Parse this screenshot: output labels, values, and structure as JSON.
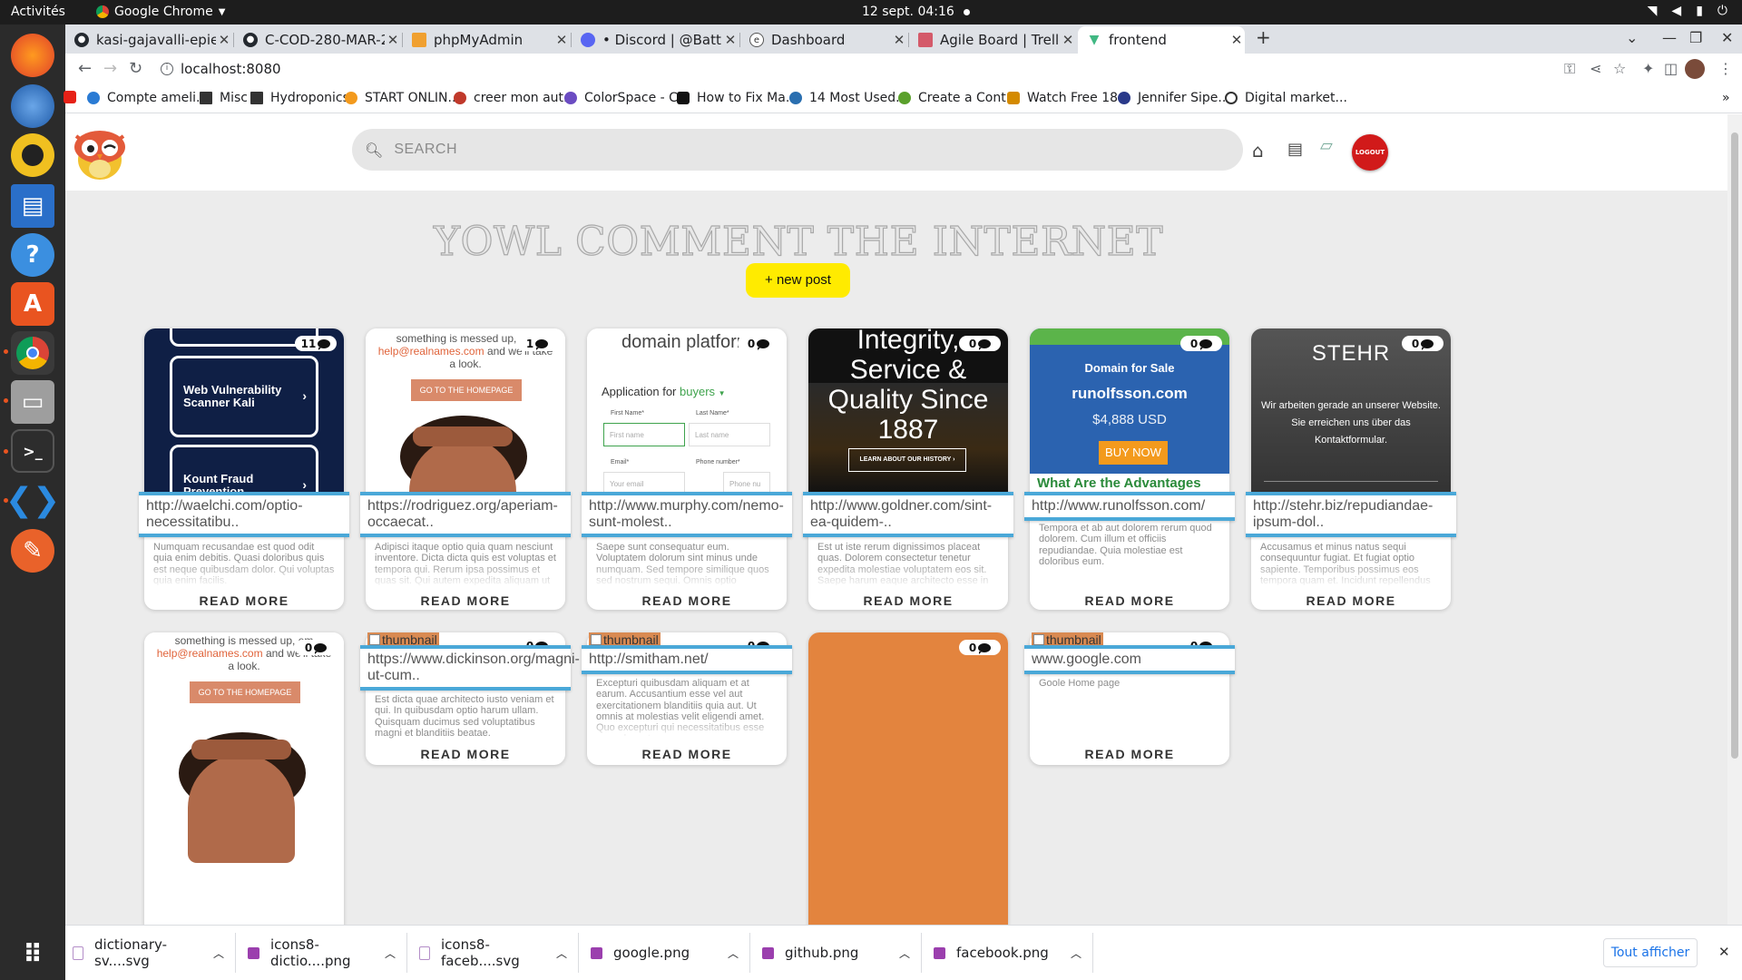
{
  "os": {
    "activities": "Activités",
    "app_name": "Google Chrome",
    "clock": "12 sept.  04:16"
  },
  "tabs": [
    {
      "title": "kasi-gajavalli-epietch/Yo",
      "icon": "github-icon"
    },
    {
      "title": "C-COD-280-MAR-2-3-dasl",
      "icon": "github-icon"
    },
    {
      "title": "phpMyAdmin",
      "icon": "phpmyadmin-icon"
    },
    {
      "title": "• Discord | @Battlemaste",
      "icon": "discord-icon"
    },
    {
      "title": "Dashboard",
      "icon": "dashboard-icon"
    },
    {
      "title": "Agile Board | Trello",
      "icon": "trello-icon"
    },
    {
      "title": "frontend",
      "icon": "vue-icon"
    }
  ],
  "omnibox": {
    "url": "localhost:8080"
  },
  "bookmarks": [
    {
      "label": "Compte ameli...",
      "color": "#2a7bd4"
    },
    {
      "label": "Misc",
      "color": "#333333"
    },
    {
      "label": "Hydroponics",
      "color": "#333333"
    },
    {
      "label": "START ONLIN...",
      "color": "#f39a1d"
    },
    {
      "label": "creer mon aut...",
      "color": "#c0392b"
    },
    {
      "label": "ColorSpace - C...",
      "color": "#6b4cc2"
    },
    {
      "label": "How to Fix Ma...",
      "color": "#111111"
    },
    {
      "label": "14 Most Used...",
      "color": "#2a6fb0"
    },
    {
      "label": "Create a Cont...",
      "color": "#5aa02c"
    },
    {
      "label": "Watch Free 18...",
      "color": "#d48a00"
    },
    {
      "label": "Jennifer Sipe...",
      "color": "#2a3a8a"
    },
    {
      "label": "Digital market...",
      "color": "#333333"
    }
  ],
  "app": {
    "search_placeholder": "SEARCH",
    "logout_label": "LOGOUT",
    "hero_title": "YOWL COMMENT THE INTERNET",
    "new_post_label": "+ new post",
    "read_more_label": "READ MORE"
  },
  "posts": [
    {
      "url": "http://waelchi.com/optio-necessitatibu..",
      "count": "11",
      "desc": "Numquam recusandae est quod odit quia enim debitis. Quasi doloribus quis est neque quibusdam dolor. Qui voluptas quia enim facilis.",
      "thumb": {
        "box1": "Web Vulnerability Scanner Kali",
        "box2": "Kount Fraud Prevention"
      }
    },
    {
      "url": "https://rodriguez.org/aperiam-occaecat..",
      "count": "1",
      "desc": "Adipisci itaque optio quia quam nesciunt inventore. Dicta dicta quis est voluptas et tempora qui. Rerum ipsa possimus et quas sit. Qui autem expedita aliquam ut sit similique asperiores qui.",
      "thumb": {
        "text1": "something is messed up, em",
        "link": "help@realnames.com",
        "text2": "and we'll take a look.",
        "button": "GO TO THE HOMEPAGE"
      }
    },
    {
      "url": "http://www.murphy.com/nemo-sunt-molest..",
      "count": "0",
      "desc": "Saepe sunt consequatur eum. Voluptatem dolorum sint minus unde numquam. Sed tempore similique quos sed nostrum sequi. Omnis optio perferendis veniam odit.",
      "thumb": {
        "heading": "domain platform",
        "application": "Application for",
        "buyers": "buyers",
        "first_name": "First Name*",
        "last_name": "Last Name*",
        "first_ph": "First name",
        "last_ph": "Last name",
        "email": "Email*",
        "phone": "Phone number*",
        "email_ph": "Your email",
        "phone_ph": "Phone nu"
      }
    },
    {
      "url": "http://www.goldner.com/sint-ea-quidem-..",
      "count": "0",
      "desc": "Est ut iste rerum dignissimos placeat quas. Dolorem consectetur tenetur expedita molestiae voluptatem eos sit. Saepe harum eaque architecto esse in quas non.",
      "thumb": {
        "big": "Integrity, Service & Quality Since 1887",
        "button": "LEARN ABOUT OUR HISTORY ›"
      }
    },
    {
      "url": "http://www.runolfsson.com/",
      "count": "0",
      "desc": "Tempora et ab aut dolorem rerum quod dolorem. Cum illum et officiis repudiandae. Quia molestiae est doloribus eum.",
      "thumb": {
        "for_sale": "Domain for Sale",
        "domain": "runolfsson.com",
        "price": "$4,888 USD",
        "buy": "BUY NOW",
        "adv": "What Are the Advantages"
      }
    },
    {
      "url": "http://stehr.biz/repudiandae-ipsum-dol..",
      "count": "0",
      "desc": "Accusamus et minus natus sequi consequuntur fugiat. Et fugiat optio sapiente. Temporibus possimus eos tempora quam et. Incidunt repellendus praesentium voluptatem neque.",
      "thumb": {
        "name": "STEHR",
        "msg": "Wir arbeiten gerade an unserer Website. Sie erreichen uns über das Kontaktformular."
      }
    },
    {
      "url": "",
      "count": "0",
      "desc": "",
      "thumb": {
        "text1": "something is messed up, em",
        "link": "help@realnames.com",
        "text2": "and we'll take a look.",
        "button": "GO TO THE HOMEPAGE"
      }
    },
    {
      "url": "https://www.dickinson.org/magni-ut-cum..",
      "count": "0",
      "desc": "Est dicta quae architecto iusto veniam et qui. In quibusdam optio harum ullam. Quisquam ducimus sed voluptatibus magni et blanditiis beatae.",
      "thumb": {
        "alt": "thumbnail"
      }
    },
    {
      "url": "http://smitham.net/",
      "count": "0",
      "desc": "Excepturi quibusdam aliquam et at earum. Accusantium esse vel aut exercitationem blanditiis quia aut. Ut omnis at molestias velit eligendi amet. Quo excepturi qui necessitatibus esse eum placeat eum.",
      "thumb": {
        "alt": "thumbnail"
      }
    },
    {
      "url": "",
      "count": "0",
      "desc": "",
      "thumb": {}
    },
    {
      "url": "www.google.com",
      "count": "0",
      "desc": "Goole Home page",
      "thumb": {
        "alt": "thumbnail"
      }
    }
  ],
  "downloads": [
    {
      "name": "dictionary-sv....svg",
      "icon": "svg-file-icon"
    },
    {
      "name": "icons8-dictio....png",
      "icon": "png-file-icon"
    },
    {
      "name": "icons8-faceb....svg",
      "icon": "svg-file-icon"
    },
    {
      "name": "google.png",
      "icon": "png-file-icon"
    },
    {
      "name": "github.png",
      "icon": "png-file-icon"
    },
    {
      "name": "facebook.png",
      "icon": "png-file-icon"
    }
  ],
  "downloads_bar": {
    "show_all": "Tout afficher"
  }
}
